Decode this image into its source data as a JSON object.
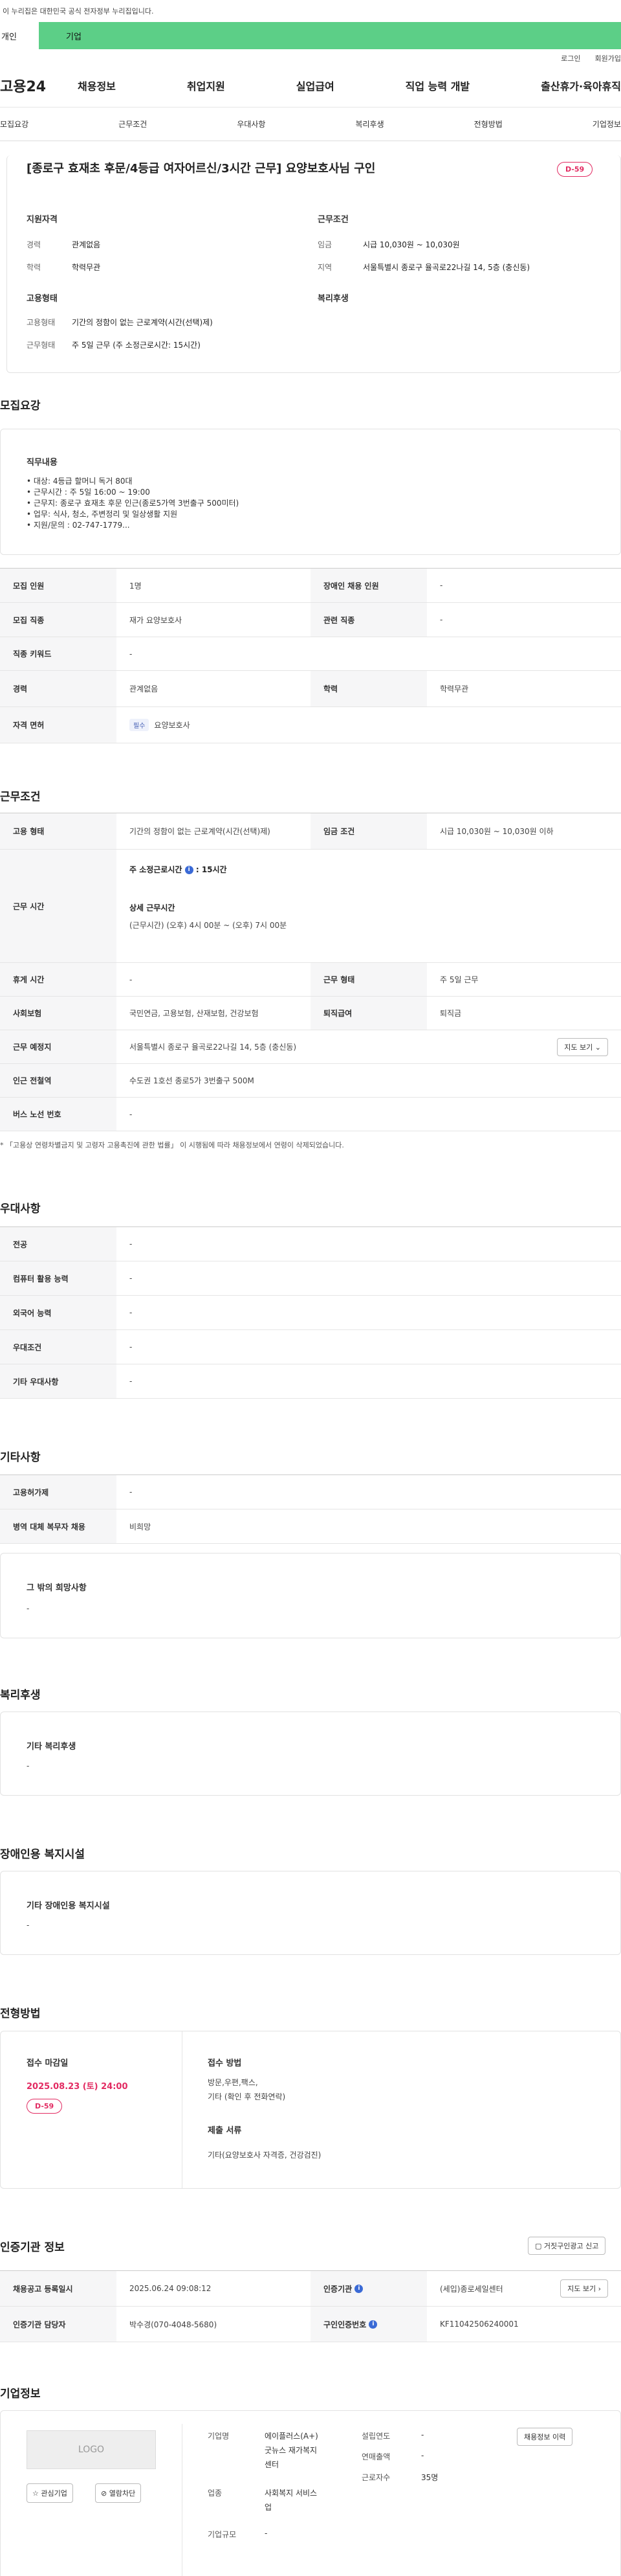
{
  "gov_banner": "이 누리집은 대한민국 공식 전자정부 누리집입니다.",
  "tabs": {
    "person": "개인",
    "company": "기업"
  },
  "util_links": [
    "로그인",
    "회원가입"
  ],
  "logo": "고용24",
  "gnb": [
    "채용정보",
    "취업지원",
    "실업급여",
    "직업 능력 개발",
    "출산휴가·육아휴직"
  ],
  "anchors": [
    "모집요강",
    "근무조건",
    "우대사항",
    "복리후생",
    "전형방법",
    "기업정보"
  ],
  "summary": {
    "title": "[종로구 효재초 후문/4등급 여자어르신/3시간 근무] 요양보호사님 구인",
    "dday": "D-59",
    "qual_head": "지원자격",
    "qual": [
      {
        "k": "경력",
        "v": "관계없음"
      },
      {
        "k": "학력",
        "v": "학력무관"
      }
    ],
    "cond_head": "근무조건",
    "cond": [
      {
        "k": "임금",
        "v": "시급 10,030원 ~ 10,030원"
      },
      {
        "k": "지역",
        "v": "서울특별시 종로구 율곡로22나길 14, 5층 (충신동)"
      }
    ],
    "emp_head": "고용형태",
    "emp": [
      {
        "k": "고용형태",
        "v": "기간의 정함이 없는 근로계약(시간(선택)제)"
      },
      {
        "k": "근무형태",
        "v": "주 5일 근무 (주 소정근로시간: 15시간)"
      }
    ],
    "welfare_head": "복리후생"
  },
  "recruit": {
    "title": "모집요강",
    "duty_head": "직무내용",
    "duty_lines": [
      "• 대상: 4등급 할머니 독거 80대",
      "• 근무시간 : 주 5일  16:00 ~ 19:00",
      "• 근무지: 종로구 효재초 후문 인근(종로5가역 3번출구 500미터)",
      "• 업무: 식사, 청소, 주변정리 및 일상생활 지원",
      "• 지원/문의 : 02-747-1779..."
    ],
    "rows": [
      {
        "k1": "모집 인원",
        "v1": "1명",
        "k2": "장애인 채용 인원",
        "v2": "-"
      },
      {
        "k1": "모집 직종",
        "v1": "재가 요양보호사",
        "k2": "관련 직종",
        "v2": "-"
      },
      {
        "k1": "직종 키워드",
        "v1": "-"
      },
      {
        "k1": "경력",
        "v1": "관계없음",
        "k2": "학력",
        "v2": "학력무관"
      }
    ],
    "license_k": "자격 면허",
    "license_tag": "필수",
    "license_v": "요양보호사"
  },
  "work": {
    "title": "근무조건",
    "emp_k": "고용 형태",
    "emp_v": "기간의 정함이 없는 근로계약(시간(선택)제)",
    "wage_k": "임금 조건",
    "wage_v": "시급 10,030원 ~ 10,030원 이하",
    "hours_k": "근무 시간",
    "hours_week": "주 소정근로시간",
    "hours_week_v": ": 15시간",
    "hours_detail_h": "상세 근무시간",
    "hours_detail_v": "(근무시간) (오후) 4시 00분 ~ (오후) 7시 00분",
    "break_k": "휴게 시간",
    "break_v": "-",
    "form_k": "근무 형태",
    "form_v": "주 5일 근무",
    "ins_k": "사회보험",
    "ins_v": "국민연금, 고용보험, 산재보험, 건강보험",
    "ret_k": "퇴직급여",
    "ret_v": "퇴직금",
    "place_k": "근무 예정지",
    "place_v": "서울특별시 종로구 율곡로22나길 14, 5층 (충신동)",
    "map_btn": "지도 보기",
    "subway_k": "인근 전철역",
    "subway_v": "수도권 1호선 종로5가 3번출구 500M",
    "bus_k": "버스 노선 번호",
    "bus_v": "-",
    "note": "* 「고용상 연령차별금지 및 고령자 고용촉진에 관한 법률」 이 시행됨에 따라 채용정보에서 연령이 삭제되었습니다."
  },
  "pref": {
    "title": "우대사항",
    "rows": [
      {
        "k": "전공",
        "v": "-"
      },
      {
        "k": "컴퓨터 활용 능력",
        "v": "-"
      },
      {
        "k": "외국어 능력",
        "v": "-"
      },
      {
        "k": "우대조건",
        "v": "-"
      },
      {
        "k": "기타 우대사항",
        "v": "-"
      }
    ]
  },
  "etc": {
    "title": "기타사항",
    "rows": [
      {
        "k": "고용허가제",
        "v": "-"
      },
      {
        "k": "병역 대체 복무자 채용",
        "v": "비희망"
      }
    ],
    "wish_head": "그 밖의 희망사항",
    "wish_v": "-"
  },
  "welfare": {
    "title": "복리후생",
    "head": "기타 복리후생",
    "v": "-"
  },
  "disabled": {
    "title": "장애인용 복지시설",
    "head": "기타 장애인용 복지시설",
    "v": "-"
  },
  "selection": {
    "title": "전형방법",
    "deadline_h": "접수 마감일",
    "deadline_v": "2025.08.23 (토) 24:00",
    "dday": "D-59",
    "method_h": "접수 방법",
    "method_v1": "방문,우편,팩스,",
    "method_v2": "기타 (확인 후 전화연락)",
    "docs_h": "제출 서류",
    "docs_v": "기타(요양보호사 자격증, 건강검진)"
  },
  "cert": {
    "title": "인증기관 정보",
    "report_btn": "거짓구인광고 신고",
    "reg_k": "채용공고 등록일시",
    "reg_v": "2025.06.24 09:08:12",
    "org_k": "인증기관",
    "org_v": "(세입)종로세일센터",
    "org_btn": "지도 보기",
    "mgr_k": "인증기관 담당자",
    "mgr_v": "박수경(070-4048-5680)",
    "no_k": "구인인증번호",
    "no_v": "KF11042506240001"
  },
  "company": {
    "title": "기업정보",
    "logo_text": "LOGO",
    "fav_btn": "관심기업",
    "block_btn": "열람차단",
    "name_k": "기업명",
    "name_v1": "에이플러스(A+)",
    "name_v2": "굿뉴스 재가복지",
    "name_v3": "센터",
    "ind_k": "업종",
    "ind_v1": "사회복지 서비스",
    "ind_v2": "업",
    "size_k": "기업규모",
    "size_v": "-",
    "year_k": "설립연도",
    "year_v": "-",
    "sales_k": "연매출액",
    "sales_v": "-",
    "emp_k": "근로자수",
    "emp_v": "35명",
    "history_btn": "채용정보 이력"
  },
  "colors": {
    "accent_green": "#5ccf87",
    "dday_red": "#e22b62",
    "info_blue": "#3a6ad6"
  }
}
